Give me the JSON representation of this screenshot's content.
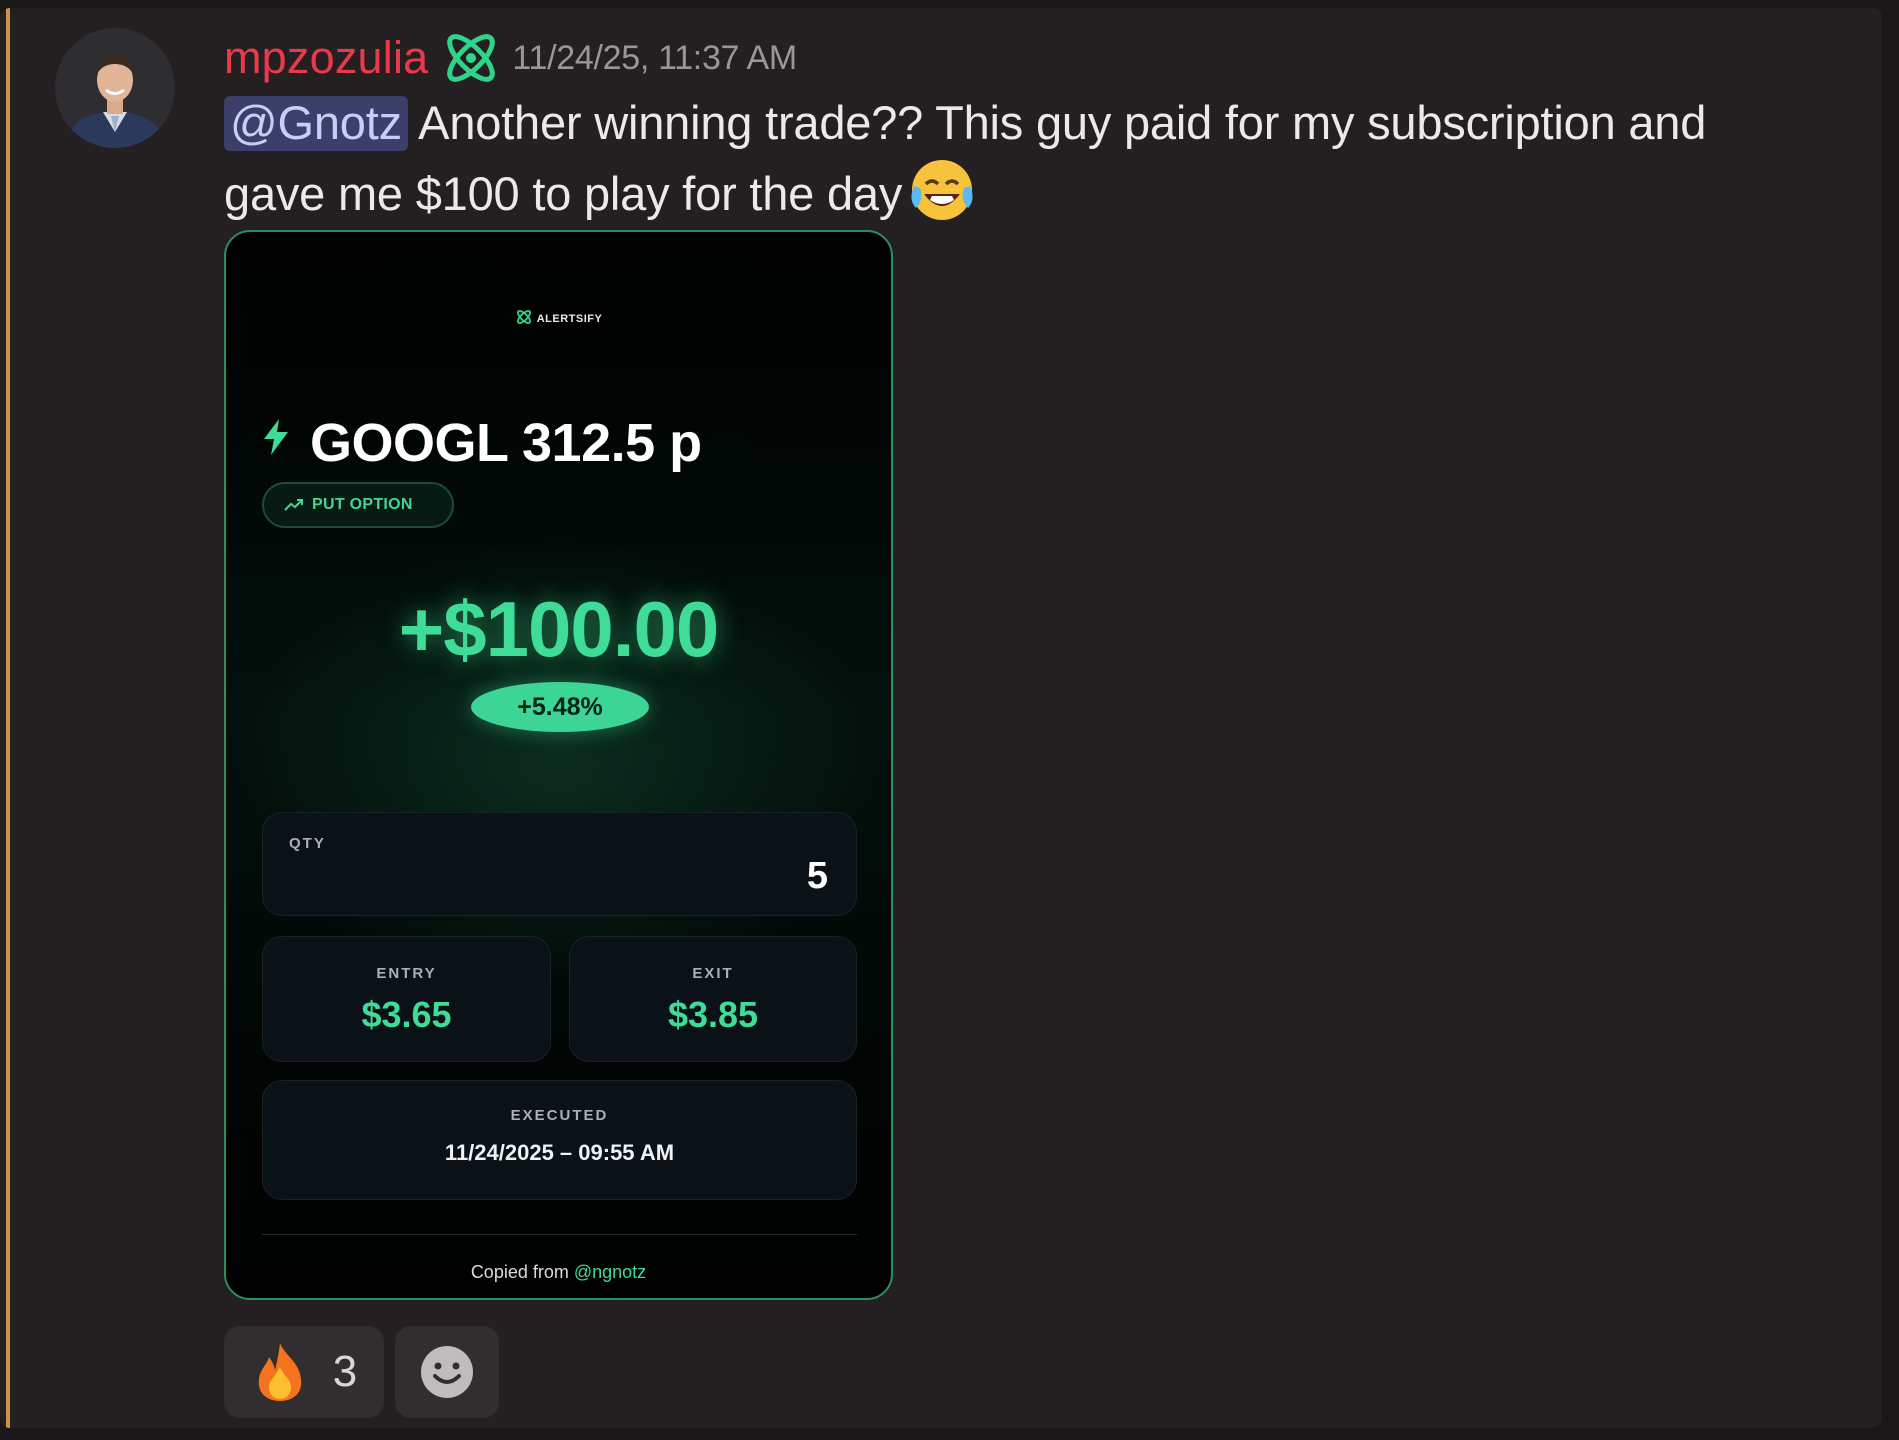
{
  "message": {
    "author": "mpzozulia",
    "timestamp": "11/24/25, 11:37 AM",
    "mention": "@Gnotz",
    "text": " Another winning trade?? This guy paid for my subscription and gave me $100 to play for the day",
    "emoji": "face-with-tears-of-joy"
  },
  "card": {
    "brand": "ALERTSIFY",
    "ticker": "GOOGL 312.5 p",
    "option_type": "PUT OPTION",
    "pnl": "+$100.00",
    "pnl_percent": "+5.48%",
    "qty_label": "QTY",
    "qty_value": "5",
    "entry_label": "ENTRY",
    "entry_value": "$3.65",
    "exit_label": "EXIT",
    "exit_value": "$3.85",
    "executed_label": "EXECUTED",
    "executed_value": "11/24/2025 – 09:55 AM",
    "copied_prefix": "Copied from ",
    "copied_handle": "@ngnotz"
  },
  "reactions": [
    {
      "emoji": "fire",
      "count": "3"
    }
  ],
  "colors": {
    "username": "#ea3a4a",
    "accent_green": "#3fdc98",
    "mention_bg": "#3b3f6a",
    "left_accent": "#c9944a"
  }
}
